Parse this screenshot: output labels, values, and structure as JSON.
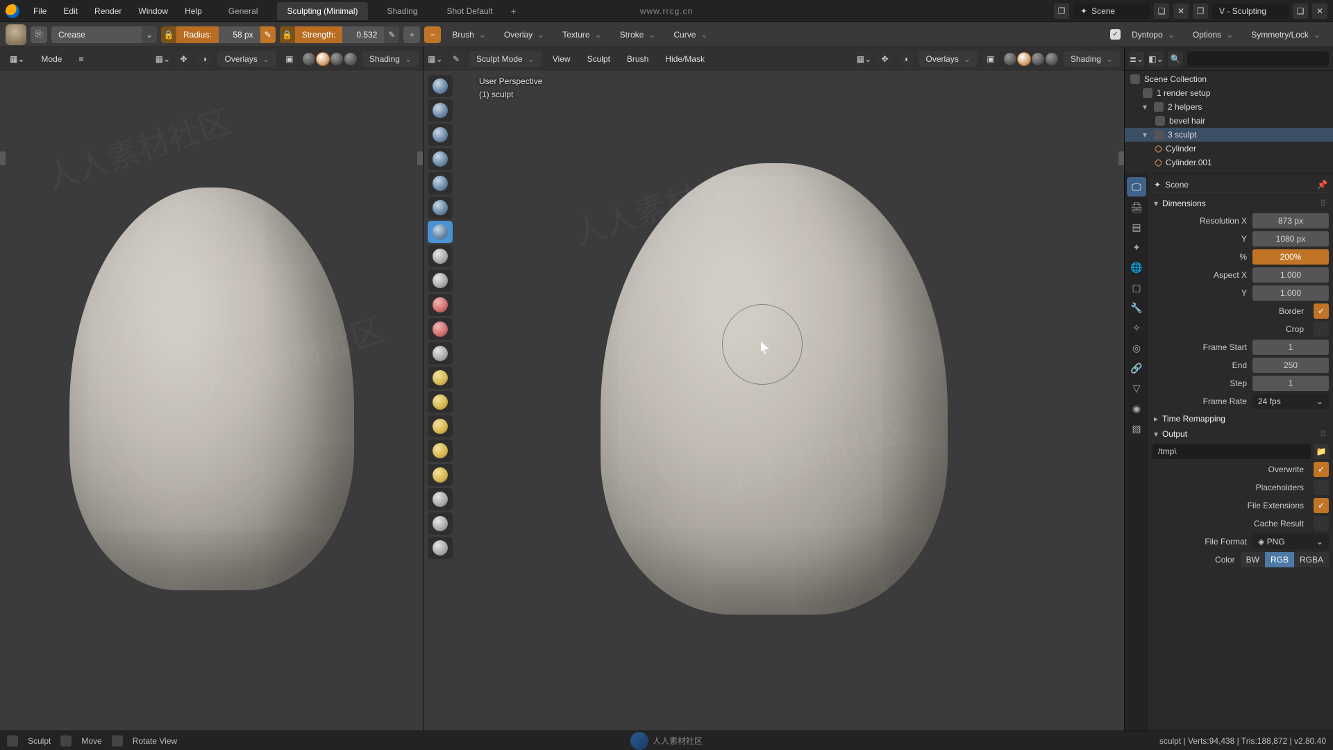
{
  "watermark": "人人素材社区",
  "menubar": {
    "items": [
      "File",
      "Edit",
      "Render",
      "Window",
      "Help"
    ],
    "workspaces": [
      "General",
      "Sculpting (Minimal)",
      "Shading",
      "Shot Default"
    ],
    "workspace_active_index": 1,
    "center_text": "www.rrcg.cn",
    "scene_label": "Scene",
    "layer_label": "V - Sculpting"
  },
  "toolbar": {
    "brush_name": "Crease",
    "radius_label": "Radius:",
    "radius_value": "58 px",
    "strength_label": "Strength:",
    "strength_value": "0.532",
    "dropdowns": [
      "Brush",
      "Overlay",
      "Texture",
      "Stroke",
      "Curve"
    ],
    "dyntopo_label": "Dyntopo",
    "options_label": "Options",
    "symmetry_label": "Symmetry/Lock"
  },
  "viewport_header": {
    "mode_label": "Sculpt Mode",
    "menus": [
      "View",
      "Sculpt",
      "Brush",
      "Hide/Mask"
    ],
    "overlays_label": "Overlays",
    "shading_label": "Shading",
    "left_mode_label": "Mode"
  },
  "overlay": {
    "line1": "User Perspective",
    "line2": "(1) sculpt"
  },
  "outliner": {
    "root": "Scene Collection",
    "items": [
      {
        "name": "1 render setup",
        "depth": 1,
        "type": "collection"
      },
      {
        "name": "2 helpers",
        "depth": 1,
        "type": "collection",
        "expanded": true
      },
      {
        "name": "bevel hair",
        "depth": 2,
        "type": "object"
      },
      {
        "name": "3 sculpt",
        "depth": 1,
        "type": "collection",
        "expanded": true,
        "active": true
      },
      {
        "name": "Cylinder",
        "depth": 2,
        "type": "mesh"
      },
      {
        "name": "Cylinder.001",
        "depth": 2,
        "type": "mesh"
      }
    ]
  },
  "properties": {
    "breadcrumb": "Scene",
    "dimensions": {
      "header": "Dimensions",
      "res_x_label": "Resolution X",
      "res_x": "873 px",
      "res_y_label": "Y",
      "res_y": "1080 px",
      "pct_label": "%",
      "pct": "200%",
      "aspect_x_label": "Aspect X",
      "aspect_x": "1.000",
      "aspect_y_label": "Y",
      "aspect_y": "1.000",
      "border_label": "Border",
      "border_on": true,
      "crop_label": "Crop",
      "crop_on": false,
      "frame_start_label": "Frame Start",
      "frame_start": "1",
      "frame_end_label": "End",
      "frame_end": "250",
      "frame_step_label": "Step",
      "frame_step": "1",
      "frame_rate_label": "Frame Rate",
      "frame_rate": "24 fps",
      "time_remap_label": "Time Remapping"
    },
    "output": {
      "header": "Output",
      "path": "/tmp\\",
      "overwrite_label": "Overwrite",
      "overwrite_on": true,
      "placeholders_label": "Placeholders",
      "placeholders_on": false,
      "ext_label": "File Extensions",
      "ext_on": true,
      "cache_label": "Cache Result",
      "cache_on": false,
      "format_label": "File Format",
      "format_value": "PNG",
      "color_label": "Color",
      "color_modes": [
        "BW",
        "RGB",
        "RGBA"
      ],
      "color_active": 1
    }
  },
  "status": {
    "left": [
      "Sculpt",
      "Move",
      "Rotate View"
    ],
    "right": "sculpt | Verts:94,438 | Tris:188,872 | v2.80.40"
  },
  "sculpt_tools": [
    "draw",
    "clay",
    "clay-strips",
    "layer",
    "inflate",
    "blob",
    "crease",
    "smooth",
    "flatten",
    "fill",
    "scrape",
    "pinch",
    "grab",
    "snake-hook",
    "thumb",
    "nudge",
    "rotate",
    "simplify",
    "mask",
    "box-mask"
  ],
  "sculpt_active_index": 6
}
